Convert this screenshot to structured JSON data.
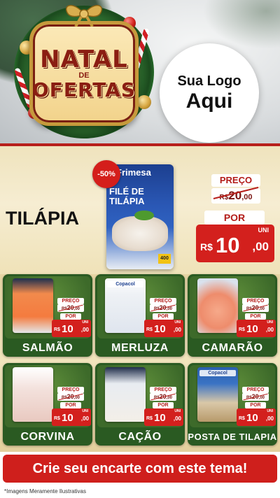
{
  "header": {
    "badge_line1": "NATAL",
    "badge_line2": "DE",
    "badge_line3": "OFERTAS",
    "logo_line1": "Sua Logo",
    "logo_line2": "Aqui"
  },
  "featured": {
    "name": "TILÁPIA",
    "discount": "-50%",
    "package_brand": "Frimesa",
    "package_name": "FILÉ DE TILÁPIA",
    "package_weight": "400",
    "price_label": "PREÇO",
    "old_currency": "R$",
    "old_value": "20",
    "old_cents": ",00",
    "por_label": "POR",
    "unit_label": "UNI",
    "currency": "R$",
    "new_value": "10",
    "new_cents": ",00"
  },
  "products": [
    {
      "name": "SALMÃO",
      "brand": "",
      "price_label": "PREÇO",
      "old_currency": "R$",
      "old_value": "20",
      "old_cents": ",00",
      "por_label": "POR",
      "unit_label": "UNI",
      "currency": "R$",
      "new_value": "10",
      "new_cents": ",00"
    },
    {
      "name": "MERLUZA",
      "brand": "Copacol",
      "price_label": "PREÇO",
      "old_currency": "R$",
      "old_value": "20",
      "old_cents": ",00",
      "por_label": "POR",
      "unit_label": "UNI",
      "currency": "R$",
      "new_value": "10",
      "new_cents": ",00"
    },
    {
      "name": "CAMARÃO",
      "brand": "",
      "price_label": "PREÇO",
      "old_currency": "R$",
      "old_value": "20",
      "old_cents": ",00",
      "por_label": "POR",
      "unit_label": "UNI",
      "currency": "R$",
      "new_value": "10",
      "new_cents": ",00"
    },
    {
      "name": "CORVINA",
      "brand": "",
      "price_label": "PREÇO",
      "old_currency": "R$",
      "old_value": "20",
      "old_cents": ",00",
      "por_label": "POR",
      "unit_label": "UNI",
      "currency": "R$",
      "new_value": "10",
      "new_cents": ",00"
    },
    {
      "name": "CAÇÃO",
      "brand": "",
      "price_label": "PREÇO",
      "old_currency": "R$",
      "old_value": "20",
      "old_cents": ",00",
      "por_label": "POR",
      "unit_label": "UNI",
      "currency": "R$",
      "new_value": "10",
      "new_cents": ",00"
    },
    {
      "name": "POSTA DE TILAPIA",
      "brand": "Copacol",
      "price_label": "PREÇO",
      "old_currency": "R$",
      "old_value": "20",
      "old_cents": ",00",
      "por_label": "POR",
      "unit_label": "UNI",
      "currency": "R$",
      "new_value": "10",
      "new_cents": ",00"
    }
  ],
  "footer": {
    "cta": "Crie seu encarte com este tema!",
    "disclaimer": "*Imagens Meramente Ilustrativas"
  },
  "colors": {
    "accent_red": "#cf1f1c",
    "card_green": "#2a5a22",
    "gold": "#c69a3c"
  }
}
